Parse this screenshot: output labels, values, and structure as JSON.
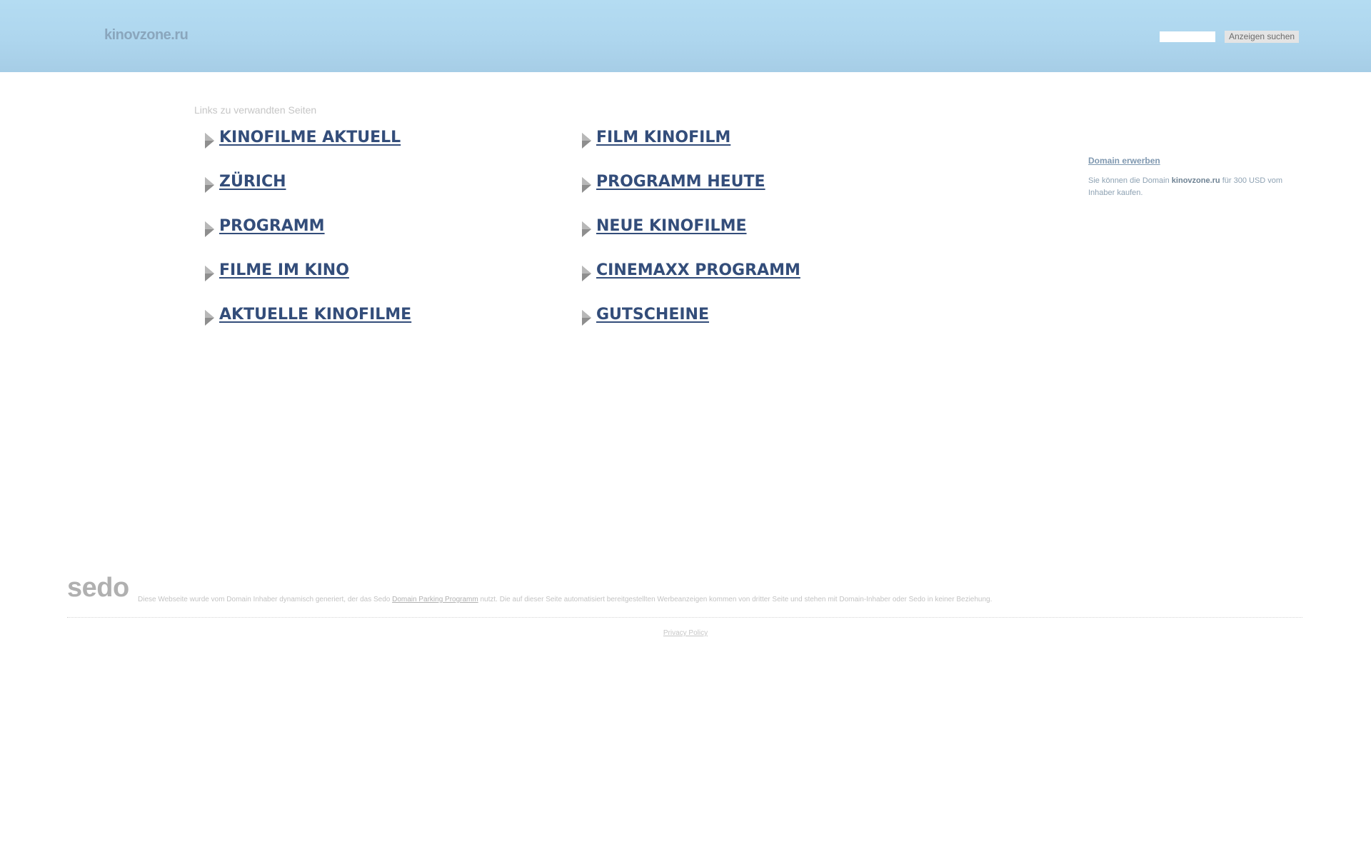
{
  "header": {
    "site_title": "kinovzone.ru",
    "search_placeholder": "",
    "search_value": "",
    "search_button": "Anzeigen suchen"
  },
  "related": {
    "heading": "Links zu verwandten Seiten",
    "left_column": [
      "KINOFILME AKTUELL",
      "ZÜRICH",
      "PROGRAMM",
      "FILME IM KINO",
      "AKTUELLE KINOFILME"
    ],
    "right_column": [
      "FILM KINOFILM",
      "PROGRAMM HEUTE",
      "NEUE KINOFILME",
      "CINEMAXX PROGRAMM",
      "GUTSCHEINE"
    ]
  },
  "sidebar": {
    "buy_link": "Domain erwerben",
    "text_before": "Sie können die Domain ",
    "domain": "kinovzone.ru",
    "text_after": " für 300 USD vom Inhaber kaufen."
  },
  "footer": {
    "logo": "sedo",
    "disclaimer_before": "Diese Webseite wurde vom Domain Inhaber dynamisch generiert, der das Sedo ",
    "disclaimer_link": "Domain Parking Programm",
    "disclaimer_after": " nutzt. Die auf dieser Seite automatisiert bereitgestellten Werbeanzeigen kommen von dritter Seite und stehen mit Domain-Inhaber oder Sedo in keiner Beziehung.",
    "privacy": "Privacy Policy"
  },
  "colors": {
    "header_bg": "#b4dcf2",
    "link_blue": "#334d7a",
    "sidebar_link": "#7f98b0"
  }
}
